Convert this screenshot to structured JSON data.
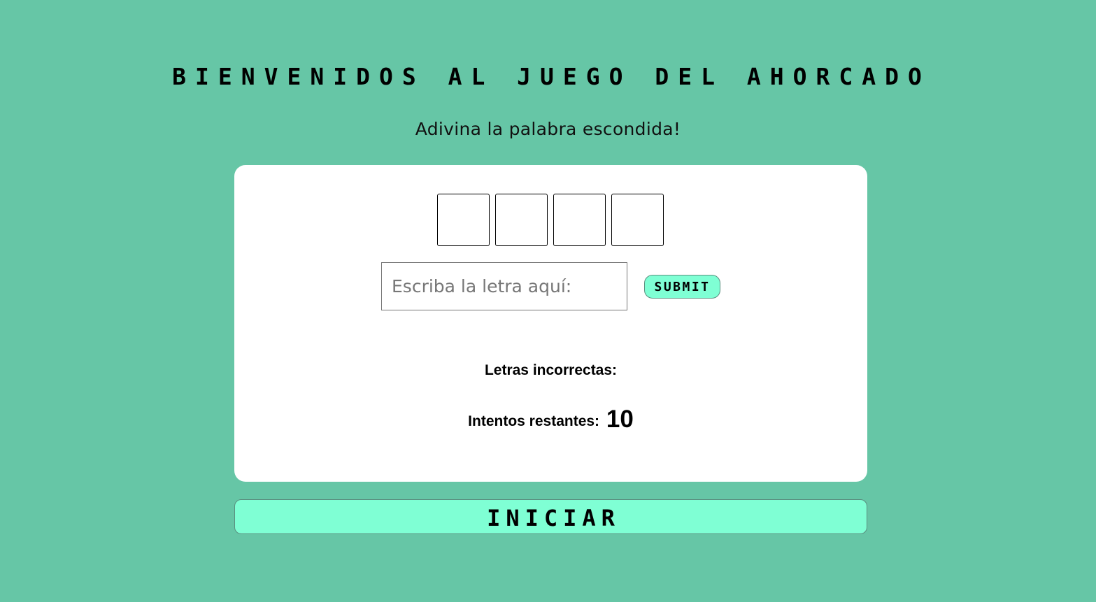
{
  "header": {
    "title": "BIENVENIDOS AL JUEGO DEL AHORCADO",
    "subtitle": "Adivina la palabra escondida!"
  },
  "game": {
    "slots": [
      "",
      "",
      "",
      ""
    ],
    "input": {
      "value": "",
      "placeholder": "Escriba la letra aquí:"
    },
    "submit_label": "SUBMIT",
    "wrong_letters_label": "Letras incorrectas:",
    "wrong_letters": "",
    "attempts_label": "Intentos restantes:",
    "attempts_count": "10"
  },
  "start_label": "INICIAR",
  "colors": {
    "background": "#66c6a6",
    "card": "#ffffff",
    "button": "#7fffd4"
  }
}
